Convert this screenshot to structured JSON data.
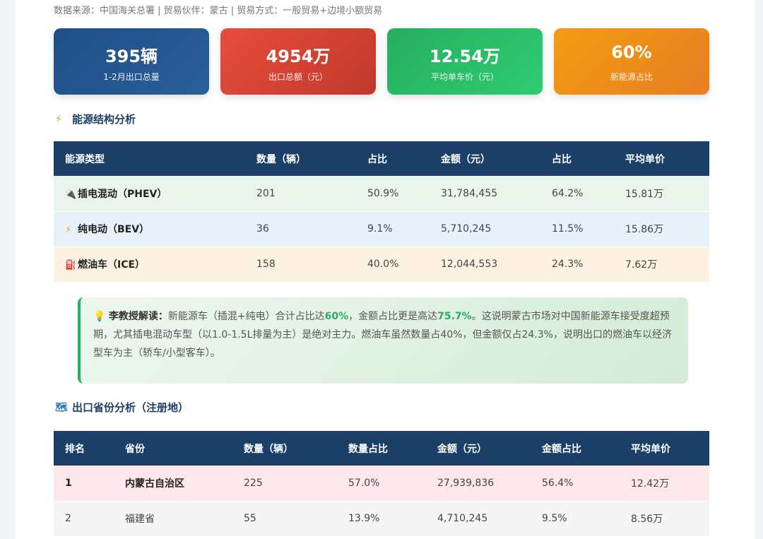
{
  "source_line": "数据来源：中国海关总署 | 贸易伙伴：蒙古 | 贸易方式：一般贸易+边境小额贸易",
  "cards": [
    {
      "value": "395辆",
      "label": "1-2月出口总量",
      "color": "#1f4f87"
    },
    {
      "value": "4954万",
      "label": "出口总额（元）",
      "color": "#e74c3c"
    },
    {
      "value": "12.54万",
      "label": "平均单车价（元）",
      "color": "#27ae60"
    },
    {
      "value": "60%",
      "label": "新能源占比",
      "color": "#f39c12"
    }
  ],
  "energy_section": {
    "title": "能源结构分析",
    "icon": "lightning-icon",
    "headers": [
      "能源类型",
      "数量（辆）",
      "占比",
      "金额（元）",
      "占比",
      "平均单价"
    ],
    "rows": [
      {
        "icon": "plug-icon",
        "type": "插电混动（PHEV）",
        "qty": "201",
        "qty_pct": "50.9%",
        "amount": "31,784,455",
        "amount_pct": "64.2%",
        "avg": "15.81万"
      },
      {
        "icon": "lightning-icon",
        "type": "纯电动（BEV）",
        "qty": "36",
        "qty_pct": "9.1%",
        "amount": "5,710,245",
        "amount_pct": "11.5%",
        "avg": "15.86万"
      },
      {
        "icon": "fuel-pump-icon",
        "type": "燃油车（ICE）",
        "qty": "158",
        "qty_pct": "40.0%",
        "amount": "12,044,553",
        "amount_pct": "24.3%",
        "avg": "7.62万"
      }
    ]
  },
  "note": {
    "icon": "lightbulb-icon",
    "lead": "李教授解读：",
    "p1": "新能源车（插混+纯电）合计占比达",
    "hl1": "60%",
    "p2": "，金额占比更是高达",
    "hl2": "75.7%",
    "p3": "。这说明蒙古市场对中国新能源车接受度超预期，尤其插电混动车型（以1.0-1.5L排量为主）是绝对主力。燃油车虽然数量占40%，但金额仅占24.3%，说明出口的燃油车以经济型车为主（轿车/小型客车）。"
  },
  "province_section": {
    "title": "出口省份分析（注册地）",
    "icon": "map-icon",
    "headers": [
      "排名",
      "省份",
      "数量（辆）",
      "数量占比",
      "金额（元）",
      "金额占比",
      "平均单价"
    ],
    "rows": [
      {
        "rank": "1",
        "province": "内蒙古自治区",
        "qty": "225",
        "qty_pct": "57.0%",
        "amount": "27,939,836",
        "amount_pct": "56.4%",
        "avg": "12.42万"
      },
      {
        "rank": "2",
        "province": "福建省",
        "qty": "55",
        "qty_pct": "13.9%",
        "amount": "4,710,245",
        "amount_pct": "9.5%",
        "avg": "8.56万"
      }
    ]
  }
}
